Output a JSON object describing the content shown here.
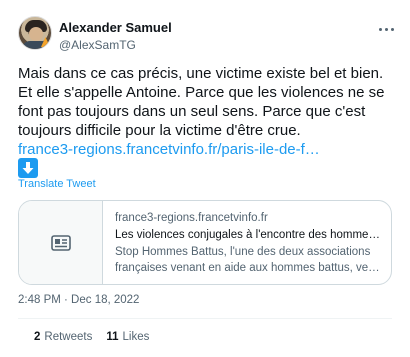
{
  "author": {
    "name": "Alexander Samuel",
    "handle": "@AlexSamTG"
  },
  "tweet": {
    "text_lines": [
      "Mais dans ce cas précis, une victime existe bel et bien.",
      "Et elle s'appelle Antoine. Parce que les violences ne se",
      "font pas toujours dans un seul sens. Parce que c'est",
      "toujours difficile pour la victime d'être crue."
    ],
    "link_text": "france3-regions.francetvinfo.fr/paris-ile-de-f…",
    "emoji_icon": "down-arrow-button-icon",
    "translate_label": "Translate Tweet"
  },
  "card": {
    "thumb_icon": "article-icon",
    "domain": "france3-regions.francetvinfo.fr",
    "title": "Les violences conjugales à l'encontre des hommes, un suje…",
    "description_lines": [
      "Stop Hommes Battus, l'une des deux associations",
      "françaises venant en aide aux hommes battus, veut briser …"
    ]
  },
  "timestamp": "2:48 PM · Dec 18, 2022",
  "stats": {
    "retweets_count": "2",
    "retweets_label": "Retweets",
    "likes_count": "11",
    "likes_label": "Likes"
  },
  "colors": {
    "accent": "#1d9bf0",
    "text": "#0f1419",
    "secondary": "#536471",
    "border": "#cfd9de"
  }
}
